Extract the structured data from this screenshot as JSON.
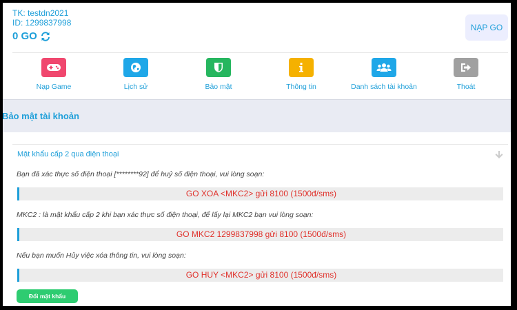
{
  "account": {
    "username_line": "TK: testdn2021",
    "id_line": "ID: 1299837998",
    "balance": "0 GO"
  },
  "topup_button": "NẠP GO",
  "nav": [
    {
      "label": "Nạp Game",
      "icon": "gamepad-icon",
      "color": "#f0476e"
    },
    {
      "label": "Lịch sử",
      "icon": "globe-icon",
      "color": "#1fa7e8"
    },
    {
      "label": "Bảo mật",
      "icon": "shield-icon",
      "color": "#26b65f"
    },
    {
      "label": "Thông tin",
      "icon": "info-icon",
      "color": "#f5b100"
    },
    {
      "label": "Danh sách tài khoản",
      "icon": "users-icon",
      "color": "#1fa7e8"
    },
    {
      "label": "Thoát",
      "icon": "sign-out-icon",
      "color": "#a0a0a0"
    }
  ],
  "section_title": "Bảo mật tài khoản",
  "panel": {
    "title": "Mật khẩu cấp 2 qua điện thoại",
    "instructions": [
      {
        "text": "Bạn đã xác thực số điện thoại [********92] để huỷ số điện thoại, vui lòng soạn:",
        "sms": "GO XOA <MKC2> gửi 8100 (1500đ/sms)"
      },
      {
        "text": "MKC2 : là mật khẩu cấp 2 khi bạn xác thực số điện thoại, để lấy lại MKC2 bạn vui lòng soạn:",
        "sms": "GO MKC2 1299837998 gửi 8100 (1500đ/sms)"
      },
      {
        "text": "Nếu bạn muốn Hủy việc xóa thông tin, vui lòng soạn:",
        "sms": "GO HUY <MKC2> gửi 8100 (1500đ/sms)"
      }
    ],
    "change_password_button": "Đổi mật khẩu"
  },
  "colors": {
    "accent": "#1e9fd9",
    "sms_text": "#e0312b",
    "button_green": "#2ecc71"
  }
}
